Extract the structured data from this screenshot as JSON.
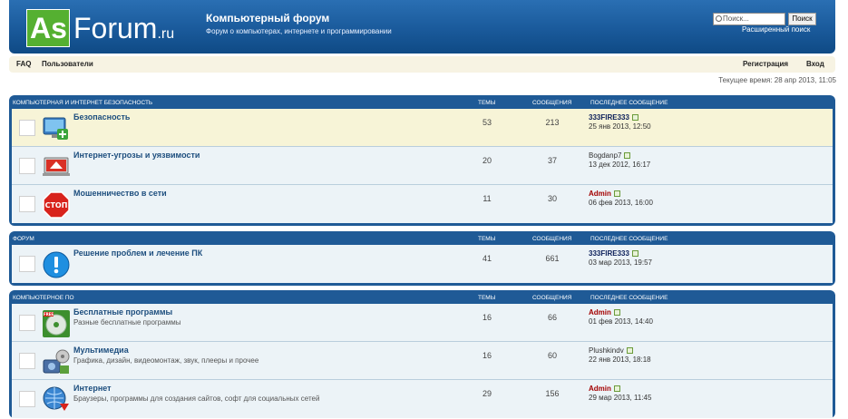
{
  "header": {
    "logo_as": "As",
    "logo_rest": "Forum",
    "logo_ru": ".ru",
    "site_title": "Компьютерный форум",
    "site_desc": "Форум о компьютерах, интернете и программировании",
    "search_placeholder": "Поиск...",
    "search_button": "Поиск",
    "advanced_search": "Расширенный поиск"
  },
  "navbar": {
    "faq": "FAQ",
    "users": "Пользователи",
    "register": "Регистрация",
    "login": "Вход"
  },
  "current_time": "Текущее время: 28 апр 2013, 11:05",
  "columns": {
    "topics": "Темы",
    "posts": "Сообщения",
    "last_post": "Последнее сообщение"
  },
  "categories": [
    {
      "title": "Компьютерная и интернет безопасность",
      "forums": [
        {
          "name": "Безопасность",
          "desc": "",
          "icon": "monitor-shield-icon",
          "topics": "53",
          "posts": "213",
          "last_user": "333FIRE333",
          "last_date": "25 янв 2013, 12:50"
        },
        {
          "name": "Интернет-угрозы и уязвимости",
          "desc": "",
          "icon": "laptop-warning-icon",
          "topics": "20",
          "posts": "37",
          "last_user": "Bogdanp7",
          "last_date": "13 дек 2012, 16:17"
        },
        {
          "name": "Мошенничество в сети",
          "desc": "",
          "icon": "stop-sign-icon",
          "topics": "11",
          "posts": "30",
          "last_user": "Admin",
          "last_date": "06 фев 2013, 16:00"
        }
      ]
    },
    {
      "title": "Форум",
      "forums": [
        {
          "name": "Решение проблем и лечение ПК",
          "desc": "",
          "icon": "info-exclamation-icon",
          "topics": "41",
          "posts": "661",
          "last_user": "333FIRE333",
          "last_date": "03 мар 2013, 19:57"
        }
      ]
    },
    {
      "title": "Компьютерное ПО",
      "forums": [
        {
          "name": "Бесплатные программы",
          "desc": "Разные бесплатные программы",
          "icon": "free-cd-icon",
          "topics": "16",
          "posts": "66",
          "last_user": "Admin",
          "last_date": "01 фев 2013, 14:40"
        },
        {
          "name": "Мультимедиа",
          "desc": "Графика, дизайн, видеомонтаж, звук, плееры и прочее",
          "icon": "multimedia-icon",
          "topics": "16",
          "posts": "60",
          "last_user": "Plushkindv",
          "last_date": "22 янв 2013, 18:18"
        },
        {
          "name": "Интернет",
          "desc": "Браузеры, программы для создания сайтов, софт для социальных сетей",
          "icon": "globe-download-icon",
          "topics": "29",
          "posts": "156",
          "last_user": "Admin",
          "last_date": "29 мар 2013, 11:45"
        }
      ]
    }
  ]
}
